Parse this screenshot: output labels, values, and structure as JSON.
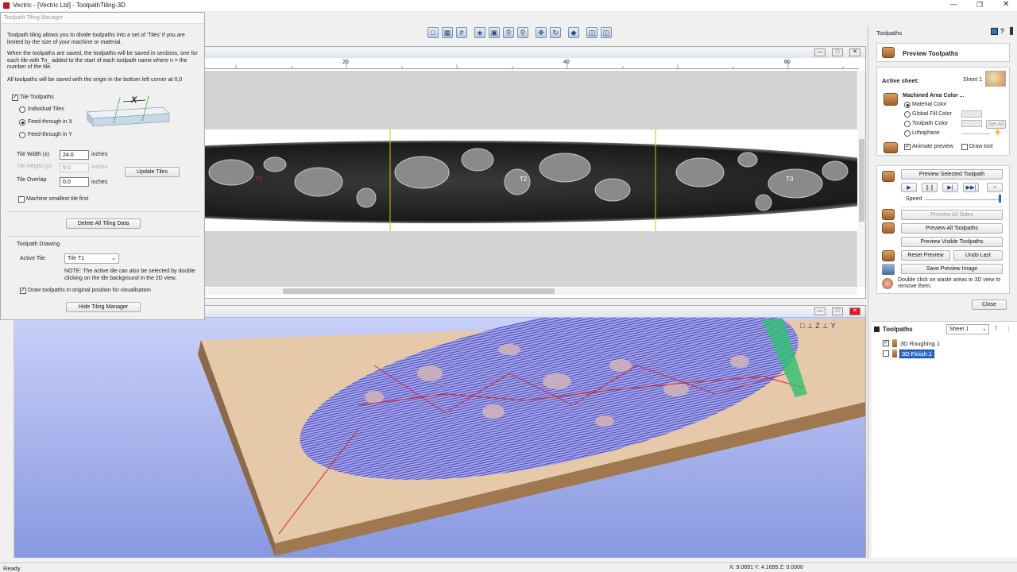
{
  "window": {
    "title": "Vectric - [Vectric Ltd] - ToolpathTiling-3D"
  },
  "status": {
    "ready": "Ready",
    "coords": "X: 9.0891 Y: 4.1695 Z: 0.0000"
  },
  "ruler": {
    "ticks": [
      "20",
      "40",
      "60"
    ]
  },
  "view2d": {
    "tile_labels": [
      "T1",
      "T2",
      "T3"
    ]
  },
  "tiling": {
    "title": "Toolpath Tiling Manager",
    "intro1": "Toolpath tiling allows you to divide toolpaths into a set of 'Tiles' if you are limited by the size of your machine or material.",
    "intro2": "When the toolpaths are saved, the toolpaths will be saved in sections, one for each tile with Tn_ added to the start of each toolpath name where n = the number of the tile.",
    "intro3": "All toolpaths will be saved with the origin in the bottom left corner at 0,0",
    "tile_toolpaths": "Tile Toolpaths",
    "individual": "Individual Tiles",
    "feed_x": "Feed-through in X",
    "feed_y": "Feed-through in Y",
    "diagram_x": "X",
    "width_label": "Tile Width (x)",
    "width_value": "24.0",
    "height_label": "Tile Height (y)",
    "height_value": "9.0",
    "overlap_label": "Tile Overlap",
    "overlap_value": "0.0",
    "units": "inches",
    "update_tiles": "Update Tiles",
    "smallest_first": "Machine smallest tile first",
    "delete_all": "Delete All Tiling Data",
    "drawing_header": "Toolpath Drawing",
    "active_tile_label": "Active Tile",
    "active_tile_value": "Tile T1",
    "note": "NOTE: The active tile can also be selected by double clicking on the tile background in the 2D view.",
    "draw_original": "Draw toolpaths in original position for visualisation",
    "hide": "Hide Tiling Manager"
  },
  "panel": {
    "header": "Toolpaths",
    "help": "?",
    "title": "Preview Toolpaths",
    "active_sheet_label": "Active sheet:",
    "active_sheet_value": "Sheet 1",
    "machined_color": "Machined Area Color ...",
    "material_color": "Material Color",
    "global_fill": "Global Fill Color",
    "toolpath_color": "Toolpath Color",
    "lithophane": "Lithophane",
    "set_all": "Set All",
    "animate": "Animate preview",
    "draw_tool": "Draw tool",
    "preview_selected": "Preview Selected Toolpath",
    "speed": "Speed",
    "preview_all_sides": "Preview All Sides",
    "preview_all": "Preview All Toolpaths",
    "preview_visible": "Preview Visible Toolpaths",
    "reset": "Reset Preview",
    "undo": "Undo Last",
    "save_image": "Save Preview Image",
    "hint": "Double click on waste areas in 3D view to remove them.",
    "close": "Close",
    "list_header": "Toolpaths",
    "sheet_select": "Sheet 1",
    "items": [
      {
        "name": "3D Roughing 1",
        "checked": true
      },
      {
        "name": "3D Finish 1",
        "checked": false
      }
    ]
  }
}
